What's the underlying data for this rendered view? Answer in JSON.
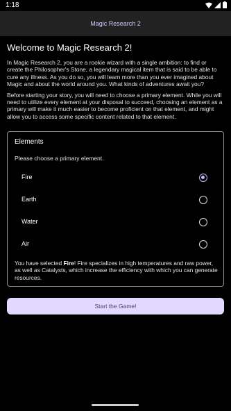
{
  "status": {
    "time": "1:18"
  },
  "app_bar": {
    "title": "Magic Research 2"
  },
  "intro": {
    "heading": "Welcome to Magic Research 2!",
    "paragraph1": "In Magic Research 2, you are a rookie wizard with a single ambition: to find or create the Philosopher's Stone, a legendary magical item that is said to be able to cure any illness. As you do so, you will learn more than you ever imagined about Magic and about the world around you. What kinds of adventures await you?",
    "paragraph2": "Before starting your story, you will need to choose a primary element. While you will need to utilize every element at your disposal to succeed, choosing an element as a primary will make it much easier to become proficient on that element, and might allow you to access some specific content related to that element."
  },
  "elements_card": {
    "title": "Elements",
    "prompt": "Please choose a primary element.",
    "options": [
      {
        "label": "Fire",
        "selected": true
      },
      {
        "label": "Earth",
        "selected": false
      },
      {
        "label": "Water",
        "selected": false
      },
      {
        "label": "Air",
        "selected": false
      }
    ],
    "selected_prefix": "You have selected ",
    "selected_name": "Fire",
    "selected_suffix": "! Fire specializes in high temperatures and raw power, as well as Catalysts, which increase the efficiency with which you can generate resources."
  },
  "start_button": {
    "label": "Start the Game!"
  },
  "colors": {
    "accent": "#c9b6ff",
    "button_bg": "#e3d8ff",
    "app_bar_bg": "#222222"
  }
}
